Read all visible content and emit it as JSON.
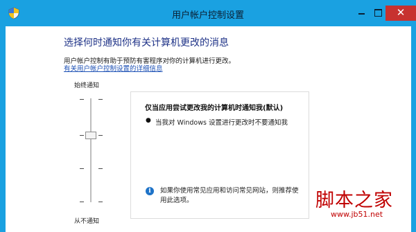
{
  "window": {
    "title": "用户帐户控制设置",
    "close_symbol": "✕"
  },
  "main": {
    "heading": "选择何时通知你有关计算机更改的消息",
    "description": "用户帐户控制有助于预防有害程序对你的计算机进行更改。",
    "details_link": "有关用户帐户控制设置的详细信息"
  },
  "slider": {
    "top_label": "始终通知",
    "bottom_label": "从不通知",
    "levels": 4,
    "selected_level": 3
  },
  "info": {
    "title": "仅当应用尝试更改我的计算机时通知我(默认)",
    "bullet": "当我对 Windows 设置进行更改时不要通知我",
    "note": "如果你使用常见应用和访问常见网站，则推荐使用此选项。",
    "icon_glyph": "i"
  },
  "watermark": {
    "title": "脚本之家",
    "url": "www.jb51.net"
  },
  "colors": {
    "title_bar": "#1aa1e1",
    "heading": "#1e3287",
    "link": "#1b4fb4",
    "close_button": "#c7322f",
    "watermark": "#c00000"
  },
  "icons": {
    "app": "uac-shield-icon",
    "info": "info-icon"
  }
}
